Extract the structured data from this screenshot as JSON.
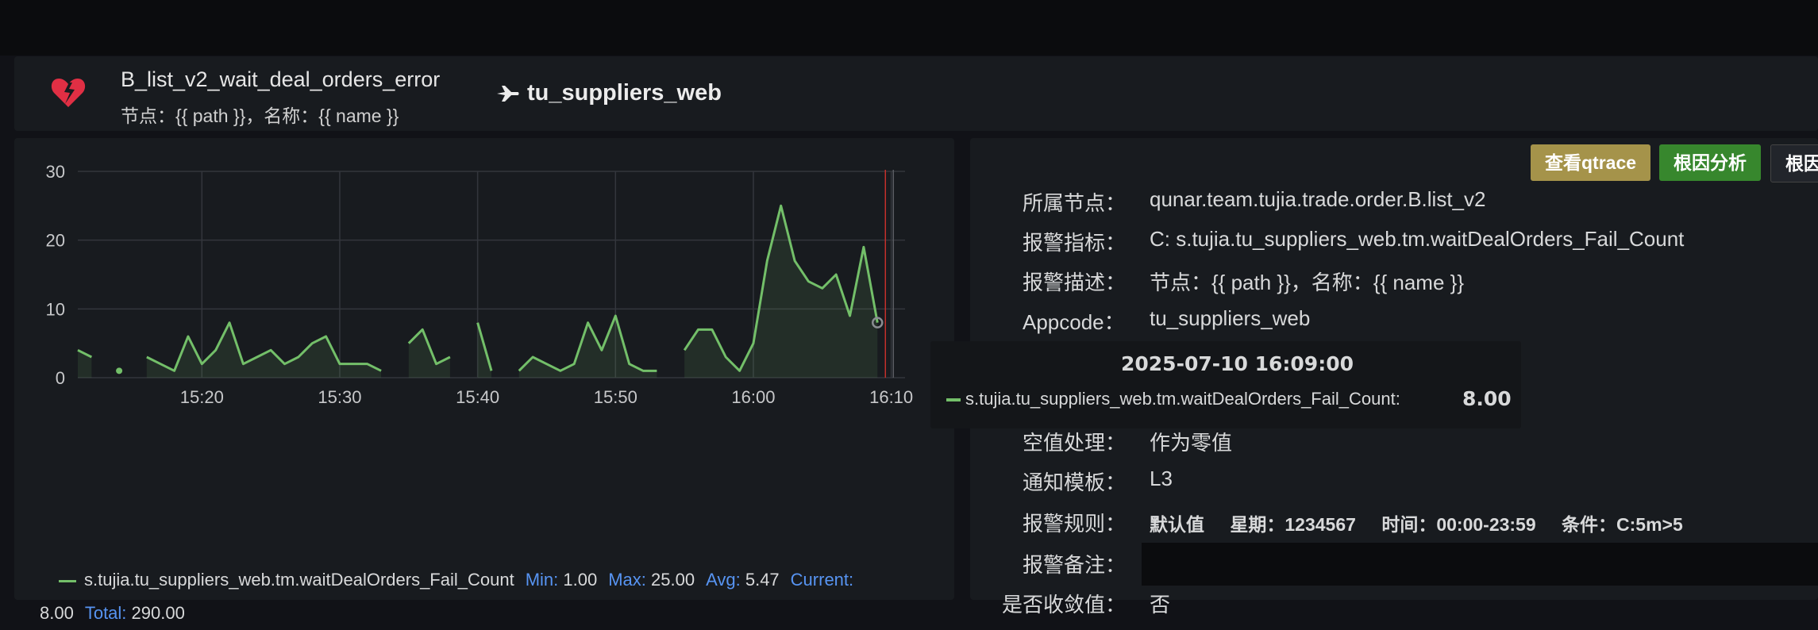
{
  "header": {
    "title": "B_list_v2_wait_deal_orders_error",
    "subtitle": "节点：{{ path }}，名称：{{ name }}",
    "app_name": "tu_suppliers_web",
    "icons": {
      "alert": "broken-heart-icon",
      "app": "airplane-icon"
    }
  },
  "colors": {
    "series": "#73bf69",
    "qtrace_button": "#a5934a",
    "root_button": "#37872d",
    "legend_key": "#5794f2"
  },
  "chart_data": {
    "type": "area",
    "x_ticks": [
      "15:20",
      "15:30",
      "15:40",
      "15:50",
      "16:00",
      "16:10"
    ],
    "y_ticks": [
      "0",
      "10",
      "20",
      "30"
    ],
    "ylim": [
      0,
      30
    ],
    "grid": true,
    "x_start": "15:11",
    "x_end": "16:11",
    "series": [
      {
        "name": "s.tujia.tu_suppliers_web.tm.waitDealOrders_Fail_Count",
        "color": "#73bf69",
        "segments": [
          [
            [
              "15:11",
              4
            ],
            [
              "15:12",
              3
            ]
          ],
          [
            [
              "15:14",
              1
            ]
          ],
          [
            [
              "15:16",
              3
            ],
            [
              "15:17",
              2
            ],
            [
              "15:18",
              1
            ],
            [
              "15:19",
              6
            ],
            [
              "15:20",
              2
            ],
            [
              "15:21",
              4
            ],
            [
              "15:22",
              8
            ],
            [
              "15:23",
              2
            ],
            [
              "15:24",
              3
            ],
            [
              "15:25",
              4
            ],
            [
              "15:26",
              2
            ],
            [
              "15:27",
              3
            ],
            [
              "15:28",
              5
            ],
            [
              "15:29",
              6
            ],
            [
              "15:30",
              2
            ],
            [
              "15:31",
              2
            ],
            [
              "15:32",
              2
            ],
            [
              "15:33",
              1
            ]
          ],
          [
            [
              "15:35",
              5
            ],
            [
              "15:36",
              7
            ],
            [
              "15:37",
              2
            ],
            [
              "15:38",
              3
            ]
          ],
          [
            [
              "15:40",
              8
            ],
            [
              "15:41",
              1
            ]
          ],
          [
            [
              "15:43",
              1
            ],
            [
              "15:44",
              3
            ],
            [
              "15:45",
              2
            ],
            [
              "15:46",
              1
            ],
            [
              "15:47",
              2
            ],
            [
              "15:48",
              8
            ],
            [
              "15:49",
              4
            ],
            [
              "15:50",
              9
            ],
            [
              "15:51",
              2
            ],
            [
              "15:52",
              1
            ],
            [
              "15:53",
              1
            ]
          ],
          [
            [
              "15:55",
              4
            ],
            [
              "15:56",
              7
            ],
            [
              "15:57",
              7
            ],
            [
              "15:58",
              3
            ],
            [
              "15:59",
              1
            ],
            [
              "16:00",
              5
            ],
            [
              "16:01",
              17
            ],
            [
              "16:02",
              25
            ],
            [
              "16:03",
              17
            ],
            [
              "16:04",
              14
            ],
            [
              "16:05",
              13
            ],
            [
              "16:06",
              15
            ],
            [
              "16:07",
              9
            ],
            [
              "16:08",
              19
            ],
            [
              "16:09",
              8
            ]
          ]
        ]
      }
    ]
  },
  "legend": {
    "series_name": "s.tujia.tu_suppliers_web.tm.waitDealOrders_Fail_Count",
    "min_label": "Min:",
    "min": "1.00",
    "max_label": "Max:",
    "max": "25.00",
    "avg_label": "Avg:",
    "avg": "5.47",
    "current_label": "Current:",
    "current": "8.00",
    "total_label": "Total:",
    "total": "290.00"
  },
  "tooltip": {
    "time": "2025-07-10 16:09:00",
    "series_name": "s.tujia.tu_suppliers_web.tm.waitDealOrders_Fail_Count:",
    "value": "8.00"
  },
  "buttons": {
    "qtrace": "查看qtrace",
    "root_cause": "根因分析",
    "root_cause_2": "根因"
  },
  "details": {
    "node_label": "所属节点：",
    "node": "qunar.team.tujia.trade.order.B.list_v2",
    "metric_label": "报警指标：",
    "metric": "C: s.tujia.tu_suppliers_web.tm.waitDealOrders_Fail_Count",
    "desc_label": "报警描述：",
    "desc": "节点：{{ path }}，名称：{{ name }}",
    "appcode_label": "Appcode：",
    "appcode": "tu_suppliers_web",
    "null_label": "空值处理：",
    "null_value": "作为零值",
    "template_label": "通知模板：",
    "template": "L3",
    "rule_label": "报警规则：",
    "rule_default": "默认值",
    "rule_week": "星期：1234567",
    "rule_time": "时间：00:00-23:59",
    "rule_cond": "条件：C:5m>5",
    "remark_label": "报警备注：",
    "partial_label": "是否收敛值：",
    "partial_value": "否"
  }
}
